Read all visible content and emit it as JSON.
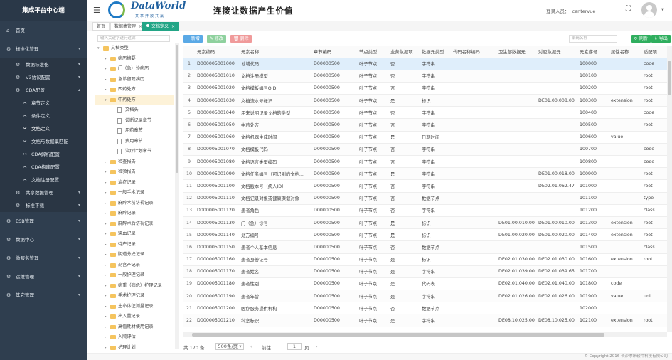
{
  "app_title": "集成平台中心端",
  "header": {
    "logo_text": "DataWorld",
    "logo_sub": "共享开放共赢",
    "slogan": "连接让数据产生价值",
    "login_label": "登录人员：",
    "login_user": "centervue"
  },
  "sidebar": {
    "items": [
      {
        "label": "首页",
        "icon": "home-icon",
        "glyph": "⌂",
        "level": 1,
        "top": true
      },
      {
        "label": "标准化管理",
        "icon": "gear-icon",
        "glyph": "⚙",
        "level": 1,
        "top": true,
        "arrow": "▾"
      },
      {
        "label": "数据标准化",
        "icon": "gear-icon",
        "glyph": "⚙",
        "level": 2,
        "arrow": "▾"
      },
      {
        "label": "V3协议配置",
        "icon": "gear-icon",
        "glyph": "⚙",
        "level": 2,
        "arrow": "▾"
      },
      {
        "label": "CDA配置",
        "icon": "gear-icon",
        "glyph": "⚙",
        "level": 2,
        "arrow": "▴"
      },
      {
        "label": "章节定义",
        "icon": "wrench-icon",
        "glyph": "✂",
        "level": 3
      },
      {
        "label": "条件定义",
        "icon": "wrench-icon",
        "glyph": "✂",
        "level": 3
      },
      {
        "label": "文档定义",
        "icon": "wrench-icon",
        "glyph": "✂",
        "level": 3,
        "active": true
      },
      {
        "label": "文档与数据集匹配",
        "icon": "wrench-icon",
        "glyph": "✂",
        "level": 3
      },
      {
        "label": "CDA解析配置",
        "icon": "wrench-icon",
        "glyph": "✂",
        "level": 3
      },
      {
        "label": "CDA构建配置",
        "icon": "wrench-icon",
        "glyph": "✂",
        "level": 3
      },
      {
        "label": "文档注册配置",
        "icon": "wrench-icon",
        "glyph": "✂",
        "level": 3
      },
      {
        "label": "共享数据管理",
        "icon": "gear-icon",
        "glyph": "⚙",
        "level": 2,
        "arrow": "▾"
      },
      {
        "label": "标准下载",
        "icon": "gear-icon",
        "glyph": "⚙",
        "level": 2,
        "arrow": "▾"
      },
      {
        "label": "ESB管理",
        "icon": "gear-icon",
        "glyph": "⚙",
        "level": 1,
        "top": true,
        "arrow": "▾"
      },
      {
        "label": "数据中心",
        "icon": "gear-icon",
        "glyph": "⚙",
        "level": 1,
        "top": true,
        "arrow": "▾"
      },
      {
        "label": "微服务管理",
        "icon": "gear-icon",
        "glyph": "⚙",
        "level": 1,
        "top": true,
        "arrow": "▾"
      },
      {
        "label": "运维管理",
        "icon": "gear-icon",
        "glyph": "⚙",
        "level": 1,
        "top": true,
        "arrow": "▾"
      },
      {
        "label": "其它管理",
        "icon": "gear-icon",
        "glyph": "⚙",
        "level": 1,
        "top": true,
        "arrow": "▾"
      }
    ]
  },
  "tabs": [
    {
      "label": "首页",
      "active": false
    },
    {
      "label": "数据集管理",
      "active": false,
      "close": "×"
    },
    {
      "label": "文档定义",
      "active": true,
      "close": "×"
    }
  ],
  "tree": {
    "search_placeholder": "输入关键字进行过滤",
    "nodes": [
      {
        "label": "文档类型",
        "level": 0,
        "kind": "folder",
        "toggle": "▾"
      },
      {
        "label": "病历摘要",
        "level": 1,
        "kind": "folder",
        "toggle": "▸"
      },
      {
        "label": "门（急）诊病历",
        "level": 1,
        "kind": "folder",
        "toggle": "▸"
      },
      {
        "label": "急诊留观病历",
        "level": 1,
        "kind": "folder",
        "toggle": "▸"
      },
      {
        "label": "西药处方",
        "level": 1,
        "kind": "folder",
        "toggle": "▸"
      },
      {
        "label": "中药处方",
        "level": 1,
        "kind": "folder",
        "toggle": "▾",
        "selected": true
      },
      {
        "label": "文档头",
        "level": 2,
        "kind": "file"
      },
      {
        "label": "诊断记录章节",
        "level": 2,
        "kind": "file"
      },
      {
        "label": "用药章节",
        "level": 2,
        "kind": "file"
      },
      {
        "label": "费用章节",
        "level": 2,
        "kind": "file"
      },
      {
        "label": "治疗计划章节",
        "level": 2,
        "kind": "file"
      },
      {
        "label": "检查报告",
        "level": 1,
        "kind": "folder",
        "toggle": "▸"
      },
      {
        "label": "检验报告",
        "level": 1,
        "kind": "folder",
        "toggle": "▸"
      },
      {
        "label": "治疗记录",
        "level": 1,
        "kind": "folder",
        "toggle": "▸"
      },
      {
        "label": "一般手术记录",
        "level": 1,
        "kind": "folder",
        "toggle": "▸"
      },
      {
        "label": "麻醉术前访视记录",
        "level": 1,
        "kind": "folder",
        "toggle": "▸"
      },
      {
        "label": "麻醉记录",
        "level": 1,
        "kind": "folder",
        "toggle": "▸"
      },
      {
        "label": "麻醉术后访视记录",
        "level": 1,
        "kind": "folder",
        "toggle": "▸"
      },
      {
        "label": "输血记录",
        "level": 1,
        "kind": "folder",
        "toggle": "▸"
      },
      {
        "label": "待产记录",
        "level": 1,
        "kind": "folder",
        "toggle": "▸"
      },
      {
        "label": "阴道分娩记录",
        "level": 1,
        "kind": "folder",
        "toggle": "▸"
      },
      {
        "label": "剖宫产记录",
        "level": 1,
        "kind": "folder",
        "toggle": "▸"
      },
      {
        "label": "一般护理记录",
        "level": 1,
        "kind": "folder",
        "toggle": "▸"
      },
      {
        "label": "病重（病危）护理记录",
        "level": 1,
        "kind": "folder",
        "toggle": "▸"
      },
      {
        "label": "手术护理记录",
        "level": 1,
        "kind": "folder",
        "toggle": "▸"
      },
      {
        "label": "生命体征测量记录",
        "level": 1,
        "kind": "folder",
        "toggle": "▸"
      },
      {
        "label": "出入量记录",
        "level": 1,
        "kind": "folder",
        "toggle": "▸"
      },
      {
        "label": "高值耗材使用记录",
        "level": 1,
        "kind": "folder",
        "toggle": "▸"
      },
      {
        "label": "入院评估",
        "level": 1,
        "kind": "folder",
        "toggle": "▸"
      },
      {
        "label": "护理计划",
        "level": 1,
        "kind": "folder",
        "toggle": "▸"
      }
    ]
  },
  "toolbar": {
    "add_label": "+ 新增",
    "edit_label": "✎ 修改",
    "delete_label": "🗑 删除",
    "search_placeholder": "编码名称",
    "refresh_label": "⟳ 刷新",
    "export_label": "⇩ 导出"
  },
  "table": {
    "columns": [
      "",
      "元素编码",
      "元素名称",
      "章节编码",
      "节点类型...",
      "业务数据项",
      "数据元类型...",
      "代码名称编码",
      "卫生部数据元...",
      "对应数据元",
      "元素序号...",
      "属性名称",
      "适配项..."
    ],
    "rows": [
      [
        "1",
        "D000005001000",
        "地域代码",
        "D00000500",
        "叶子节点",
        "否",
        "字符串",
        "",
        "",
        "",
        "100000",
        "",
        "code"
      ],
      [
        "2",
        "D000005001010",
        "文档注册模型",
        "D00000500",
        "叶子节点",
        "否",
        "字符串",
        "",
        "",
        "",
        "100100",
        "",
        "root"
      ],
      [
        "3",
        "D000005001020",
        "文档模板编号OID",
        "D00000500",
        "叶子节点",
        "否",
        "字符串",
        "",
        "",
        "",
        "100200",
        "",
        "root"
      ],
      [
        "4",
        "D000005001030",
        "文档流水号标识",
        "D00000500",
        "叶子节点",
        "是",
        "标识",
        "",
        "",
        "DE01.00.008.00",
        "100300",
        "extension",
        "root"
      ],
      [
        "5",
        "D000005001040",
        "用来说明记录文档的类型",
        "D00000500",
        "叶子节点",
        "否",
        "字符串",
        "",
        "",
        "",
        "100400",
        "",
        "code"
      ],
      [
        "6",
        "D000005001050",
        "中药处方",
        "D00000500",
        "叶子节点",
        "否",
        "字符串",
        "",
        "",
        "",
        "100500",
        "",
        "root"
      ],
      [
        "7",
        "D000005001060",
        "文档机器生成时间",
        "D00000500",
        "叶子节点",
        "是",
        "日期时间",
        "",
        "",
        "",
        "100600",
        "value",
        ""
      ],
      [
        "8",
        "D000005001070",
        "文档模板代码",
        "D00000500",
        "叶子节点",
        "否",
        "字符串",
        "",
        "",
        "",
        "100700",
        "",
        "code"
      ],
      [
        "9",
        "D000005001080",
        "文档语言类型编码",
        "D00000500",
        "叶子节点",
        "否",
        "字符串",
        "",
        "",
        "",
        "100800",
        "",
        "code"
      ],
      [
        "10",
        "D000005001090",
        "文档任务编号（可识别的文档...",
        "D00000500",
        "叶子节点",
        "是",
        "字符串",
        "",
        "",
        "DE01.00.018.00",
        "100900",
        "",
        "root"
      ],
      [
        "11",
        "D000005001100",
        "文档版本号（病人ID）",
        "D00000500",
        "叶子节点",
        "否",
        "字符串",
        "",
        "",
        "DE02.01.062.47",
        "101000",
        "",
        "root"
      ],
      [
        "12",
        "D000005001110",
        "文档记录对象或健康保健对象",
        "D00000500",
        "叶子节点",
        "否",
        "数据节点",
        "",
        "",
        "",
        "101100",
        "",
        "type"
      ],
      [
        "13",
        "D000005001120",
        "患者角色",
        "D00000500",
        "叶子节点",
        "否",
        "字符串",
        "",
        "",
        "",
        "101200",
        "",
        "class"
      ],
      [
        "14",
        "D000005001130",
        "门（急）诊号",
        "D00000500",
        "叶子节点",
        "是",
        "标识",
        "",
        "DE01.00.010.00",
        "DE01.00.010.00",
        "101300",
        "extension",
        "root"
      ],
      [
        "15",
        "D000005001140",
        "处方编号",
        "D00000500",
        "叶子节点",
        "是",
        "标识",
        "",
        "DE01.00.020.00",
        "DE01.00.020.00",
        "101400",
        "extension",
        "root"
      ],
      [
        "16",
        "D000005001150",
        "患者个人基本信息",
        "D00000500",
        "叶子节点",
        "否",
        "数据节点",
        "",
        "",
        "",
        "101500",
        "",
        "class"
      ],
      [
        "17",
        "D000005001160",
        "患者身份证号",
        "D00000500",
        "叶子节点",
        "是",
        "标识",
        "",
        "DE02.01.030.00",
        "DE02.01.030.00",
        "101600",
        "extension",
        "root"
      ],
      [
        "18",
        "D000005001170",
        "患者姓名",
        "D00000500",
        "叶子节点",
        "是",
        "字符串",
        "",
        "DE02.01.039.00",
        "DE02.01.039.65",
        "101700",
        "",
        ""
      ],
      [
        "19",
        "D000005001180",
        "患者性别",
        "D00000500",
        "叶子节点",
        "是",
        "代码表",
        "",
        "DE02.01.040.00",
        "DE02.01.040.00",
        "101800",
        "code",
        ""
      ],
      [
        "20",
        "D000005001190",
        "患者年龄",
        "D00000500",
        "叶子节点",
        "是",
        "字符串",
        "",
        "DE02.01.026.00",
        "DE02.01.026.00",
        "101900",
        "value",
        "unit"
      ],
      [
        "21",
        "D000005001200",
        "医疗服务提供机构",
        "D00000500",
        "叶子节点",
        "否",
        "数据节点",
        "",
        "",
        "",
        "102000",
        "",
        ""
      ],
      [
        "22",
        "D000005001210",
        "科室标识",
        "D00000500",
        "叶子节点",
        "是",
        "字符串",
        "",
        "DE08.10.025.00",
        "DE08.10.025.00",
        "102100",
        "extension",
        "root"
      ]
    ]
  },
  "pager": {
    "total": "共 170 条",
    "page_size": "500条/页 ▾",
    "prev_label": "前往",
    "page": "1",
    "unit": "页",
    "nav_left": "‹",
    "nav_right": "›"
  },
  "footer": "© Copyright 2016 长沙摩讯软件科技有限公司"
}
